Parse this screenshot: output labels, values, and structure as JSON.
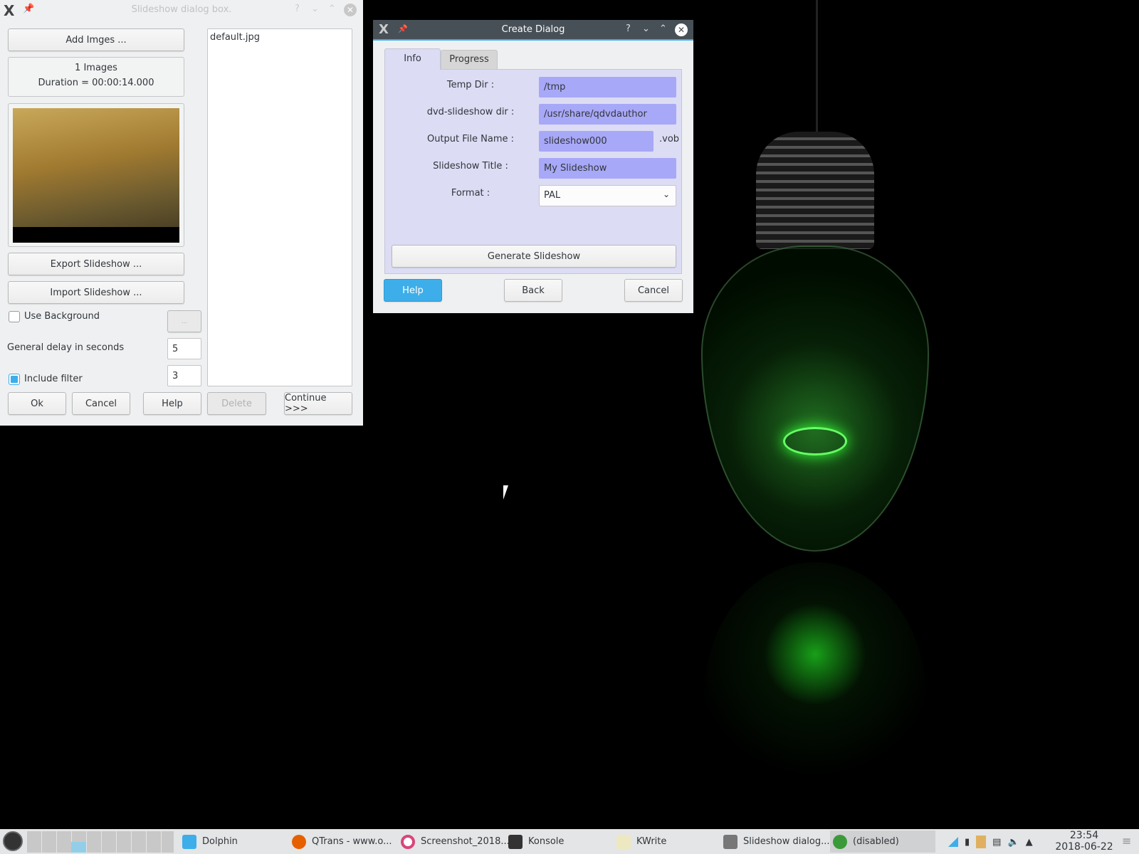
{
  "slideshow_dialog": {
    "title": "Slideshow dialog box.",
    "add_images": "Add Imges ...",
    "image_count": "1 Images",
    "duration": "Duration = 00:00:14.000",
    "export": "Export Slideshow ...",
    "import": "Import Slideshow ...",
    "use_background": "Use Background",
    "use_background_checked": false,
    "browse": "...",
    "delay_label": "General delay in seconds",
    "delay_value": "5",
    "include_filter": "Include filter",
    "include_filter_checked": true,
    "filter_value": "3",
    "files": [
      "default.jpg"
    ],
    "buttons": {
      "ok": "Ok",
      "cancel": "Cancel",
      "help": "Help",
      "delete": "Delete",
      "continue": "Continue >>>"
    }
  },
  "create_dialog": {
    "title": "Create Dialog",
    "tabs": [
      "Info",
      "Progress"
    ],
    "active_tab": "Info",
    "fields": {
      "temp_dir_label": "Temp Dir :",
      "temp_dir": "/tmp",
      "dvd_dir_label": "dvd-slideshow dir :",
      "dvd_dir": "/usr/share/qdvdauthor",
      "output_label": "Output File Name :",
      "output": "slideshow000",
      "output_ext": ".vob",
      "title_label": "Slideshow Title :",
      "title": "My Slideshow",
      "format_label": "Format :",
      "format": "PAL"
    },
    "generate": "Generate Slideshow",
    "help": "Help",
    "back": "Back",
    "cancel": "Cancel",
    "accent": "#3daee9"
  },
  "taskbar": {
    "tasks": [
      "Dolphin",
      "QTrans - www.o...",
      "Screenshot_2018...",
      "Konsole",
      "KWrite",
      "Slideshow dialog...",
      "(disabled)"
    ],
    "time": "23:54",
    "date": "2018-06-22"
  }
}
